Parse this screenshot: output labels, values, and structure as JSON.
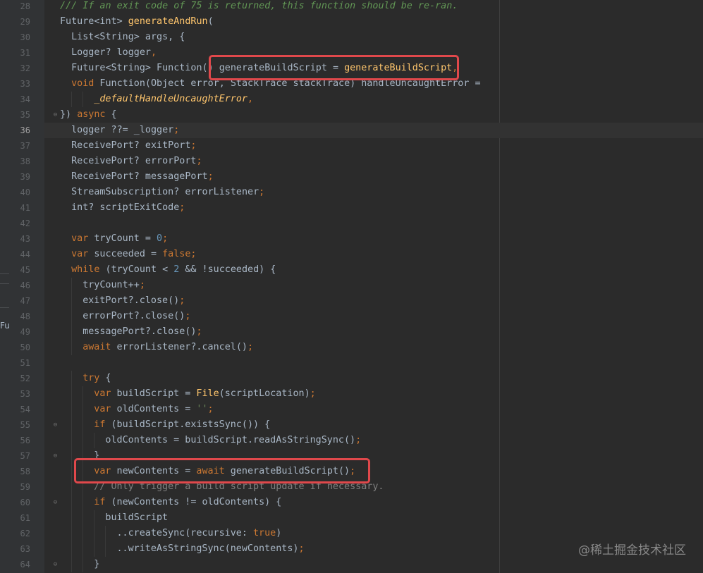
{
  "side_panel_label": "Fu",
  "current_line": "36",
  "watermark": "@稀土掘金技术社区",
  "code": [
    {
      "n": "28",
      "indent": 0,
      "tokens": [
        {
          "t": "/// If an exit code of 75 is returned, this function should be re-ran.",
          "c": "cm"
        }
      ]
    },
    {
      "n": "29",
      "indent": 0,
      "tokens": [
        {
          "t": "Future<int> "
        },
        {
          "t": "generateAndRun",
          "c": "fn"
        },
        {
          "t": "("
        }
      ]
    },
    {
      "n": "30",
      "indent": 1,
      "tokens": [
        {
          "t": "List<String> args, {"
        }
      ]
    },
    {
      "n": "31",
      "indent": 1,
      "tokens": [
        {
          "t": "Logger? logger"
        },
        {
          "t": ",",
          "c": "kw"
        }
      ]
    },
    {
      "n": "32",
      "indent": 1,
      "tokens": [
        {
          "t": "Future<String> Function() generateBuildScript = "
        },
        {
          "t": "generateBuildScript",
          "c": "fn"
        },
        {
          "t": ",",
          "c": "kw"
        }
      ]
    },
    {
      "n": "33",
      "indent": 1,
      "tokens": [
        {
          "t": "void",
          "c": "kw"
        },
        {
          "t": " Function(Object error, StackTrace stackTrace) handleUncaughtError ="
        }
      ]
    },
    {
      "n": "34",
      "indent": 3,
      "tokens": [
        {
          "t": "_defaultHandleUncaughtError",
          "c": "fn ital"
        },
        {
          "t": ",",
          "c": "kw"
        }
      ]
    },
    {
      "n": "35",
      "indent": 0,
      "tokens": [
        {
          "t": "}) "
        },
        {
          "t": "async",
          "c": "kw"
        },
        {
          "t": " {"
        }
      ]
    },
    {
      "n": "36",
      "indent": 1,
      "tokens": [
        {
          "t": "logger ??= _logger"
        },
        {
          "t": ";",
          "c": "kw"
        }
      ]
    },
    {
      "n": "37",
      "indent": 1,
      "tokens": [
        {
          "t": "ReceivePort? exitPort"
        },
        {
          "t": ";",
          "c": "kw"
        }
      ]
    },
    {
      "n": "38",
      "indent": 1,
      "tokens": [
        {
          "t": "ReceivePort? errorPort"
        },
        {
          "t": ";",
          "c": "kw"
        }
      ]
    },
    {
      "n": "39",
      "indent": 1,
      "tokens": [
        {
          "t": "ReceivePort? messagePort"
        },
        {
          "t": ";",
          "c": "kw"
        }
      ]
    },
    {
      "n": "40",
      "indent": 1,
      "tokens": [
        {
          "t": "StreamSubscription? errorListener"
        },
        {
          "t": ";",
          "c": "kw"
        }
      ]
    },
    {
      "n": "41",
      "indent": 1,
      "tokens": [
        {
          "t": "int? scriptExitCode"
        },
        {
          "t": ";",
          "c": "kw"
        }
      ]
    },
    {
      "n": "42",
      "indent": 0,
      "tokens": []
    },
    {
      "n": "43",
      "indent": 1,
      "tokens": [
        {
          "t": "var",
          "c": "kw"
        },
        {
          "t": " tryCount = "
        },
        {
          "t": "0",
          "c": "num"
        },
        {
          "t": ";",
          "c": "kw"
        }
      ]
    },
    {
      "n": "44",
      "indent": 1,
      "tokens": [
        {
          "t": "var",
          "c": "kw"
        },
        {
          "t": " succeeded = "
        },
        {
          "t": "false",
          "c": "kw"
        },
        {
          "t": ";",
          "c": "kw"
        }
      ]
    },
    {
      "n": "45",
      "indent": 1,
      "tokens": [
        {
          "t": "while",
          "c": "kw"
        },
        {
          "t": " (tryCount < "
        },
        {
          "t": "2",
          "c": "num"
        },
        {
          "t": " && !succeeded) {"
        }
      ]
    },
    {
      "n": "46",
      "indent": 2,
      "tokens": [
        {
          "t": "tryCount++"
        },
        {
          "t": ";",
          "c": "kw"
        }
      ]
    },
    {
      "n": "47",
      "indent": 2,
      "tokens": [
        {
          "t": "exitPort?.close()"
        },
        {
          "t": ";",
          "c": "kw"
        }
      ]
    },
    {
      "n": "48",
      "indent": 2,
      "tokens": [
        {
          "t": "errorPort?.close()"
        },
        {
          "t": ";",
          "c": "kw"
        }
      ]
    },
    {
      "n": "49",
      "indent": 2,
      "tokens": [
        {
          "t": "messagePort?.close()"
        },
        {
          "t": ";",
          "c": "kw"
        }
      ]
    },
    {
      "n": "50",
      "indent": 2,
      "tokens": [
        {
          "t": "await",
          "c": "kw"
        },
        {
          "t": " errorListener?.cancel()"
        },
        {
          "t": ";",
          "c": "kw"
        }
      ]
    },
    {
      "n": "51",
      "indent": 0,
      "tokens": []
    },
    {
      "n": "52",
      "indent": 2,
      "tokens": [
        {
          "t": "try",
          "c": "kw"
        },
        {
          "t": " {"
        }
      ]
    },
    {
      "n": "53",
      "indent": 3,
      "tokens": [
        {
          "t": "var",
          "c": "kw"
        },
        {
          "t": " buildScript = "
        },
        {
          "t": "File",
          "c": "fn"
        },
        {
          "t": "(scriptLocation)"
        },
        {
          "t": ";",
          "c": "kw"
        }
      ]
    },
    {
      "n": "54",
      "indent": 3,
      "tokens": [
        {
          "t": "var",
          "c": "kw"
        },
        {
          "t": " oldContents = "
        },
        {
          "t": "''",
          "c": "str"
        },
        {
          "t": ";",
          "c": "kw"
        }
      ]
    },
    {
      "n": "55",
      "indent": 3,
      "tokens": [
        {
          "t": "if",
          "c": "kw"
        },
        {
          "t": " (buildScript.existsSync()) {"
        }
      ]
    },
    {
      "n": "56",
      "indent": 4,
      "tokens": [
        {
          "t": "oldContents = buildScript.readAsStringSync()"
        },
        {
          "t": ";",
          "c": "kw"
        }
      ]
    },
    {
      "n": "57",
      "indent": 3,
      "tokens": [
        {
          "t": "}"
        }
      ]
    },
    {
      "n": "58",
      "indent": 3,
      "tokens": [
        {
          "t": "var",
          "c": "kw"
        },
        {
          "t": " newContents = "
        },
        {
          "t": "await",
          "c": "kw"
        },
        {
          "t": " generateBuildScript()"
        },
        {
          "t": ";",
          "c": "kw"
        }
      ]
    },
    {
      "n": "59",
      "indent": 3,
      "tokens": [
        {
          "t": "// Only trigger a build script update if necessary.",
          "c": "lc"
        }
      ]
    },
    {
      "n": "60",
      "indent": 3,
      "tokens": [
        {
          "t": "if",
          "c": "kw"
        },
        {
          "t": " (newContents != oldContents) {"
        }
      ]
    },
    {
      "n": "61",
      "indent": 4,
      "tokens": [
        {
          "t": "buildScript"
        }
      ]
    },
    {
      "n": "62",
      "indent": 5,
      "tokens": [
        {
          "t": "..createSync(recursive: "
        },
        {
          "t": "true",
          "c": "kw"
        },
        {
          "t": ")"
        }
      ]
    },
    {
      "n": "63",
      "indent": 5,
      "tokens": [
        {
          "t": "..writeAsStringSync(newContents)"
        },
        {
          "t": ";",
          "c": "kw"
        }
      ]
    },
    {
      "n": "64",
      "indent": 3,
      "tokens": [
        {
          "t": "}"
        }
      ]
    }
  ],
  "fold_markers": [
    "35",
    "55",
    "57",
    "60",
    "64"
  ],
  "highlight_boxes": [
    "32",
    "58"
  ]
}
